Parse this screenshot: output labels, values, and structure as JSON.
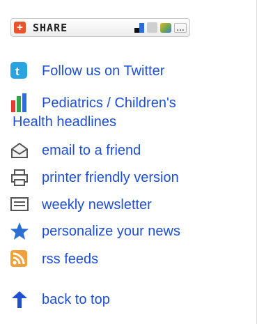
{
  "share": {
    "label": "SHARE",
    "more": "…"
  },
  "links": {
    "twitter": "Follow us on Twitter",
    "headlines_line1": "Pediatrics / Children's",
    "headlines_line2": "Health headlines",
    "email": "email to a friend",
    "printer": "printer friendly version",
    "newsletter": "weekly newsletter",
    "personalize": "personalize your news",
    "rss": "rss feeds",
    "back_to_top": "back to top"
  },
  "colors": {
    "link": "#1f4fd1",
    "share_plus": "#e8542d",
    "twitter": "#2aa3e1",
    "star": "#2b6fd6",
    "rss": "#f2a13a"
  }
}
